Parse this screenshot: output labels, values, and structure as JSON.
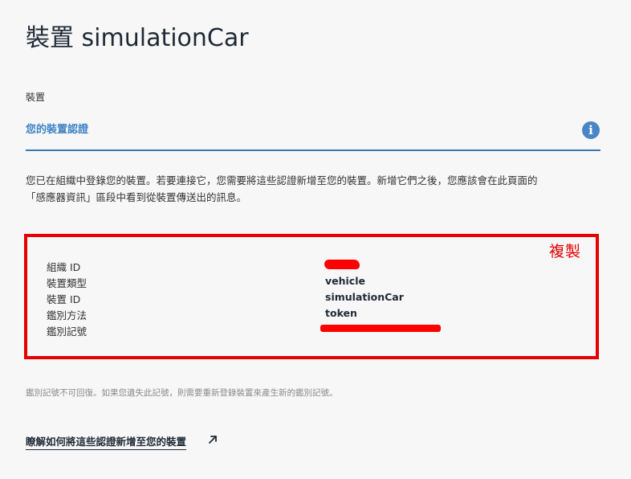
{
  "page": {
    "title": "裝置 simulationCar",
    "breadcrumb": "裝置"
  },
  "section": {
    "title": "您的裝置認證",
    "info_icon": "info-icon",
    "description_line1": "您已在組織中登錄您的裝置。若要連接它，您需要將這些認證新增至您的裝置。新增它們之後，您應該會在此頁面的",
    "description_line2": "「感應器資訊」區段中看到從裝置傳送出的訊息。"
  },
  "credentials": {
    "copy_label": "複製",
    "rows": [
      {
        "label": "組織 ID",
        "value": ""
      },
      {
        "label": "裝置類型",
        "value": "vehicle"
      },
      {
        "label": "裝置 ID",
        "value": "simulationCar"
      },
      {
        "label": "鑑別方法",
        "value": "token"
      },
      {
        "label": "鑑別記號",
        "value": ""
      }
    ]
  },
  "footnote": "鑑別記號不可回復。如果您遺失此記號，則需要重新登錄裝置來產生新的鑑別記號。",
  "learn_more": {
    "label": "瞭解如何將這些認證新增至您的裝置",
    "icon": "external-link-icon"
  },
  "colors": {
    "accent": "#3f83c4",
    "annotation_red": "#e60000",
    "background": "#f7f7f7"
  }
}
